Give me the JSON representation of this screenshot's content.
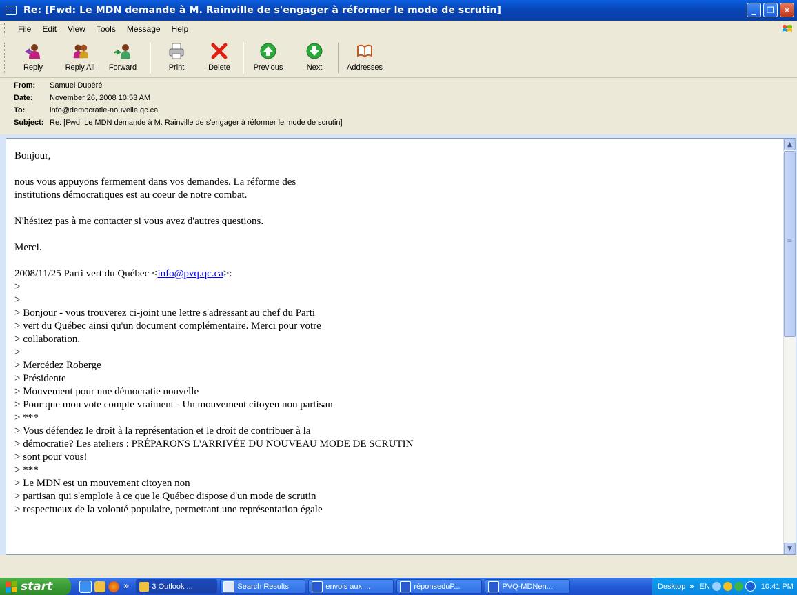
{
  "window": {
    "title": "Re: [Fwd: Le MDN demande à M. Rainville de s'engager à réformer le mode de scrutin]",
    "minimize": "_",
    "maximize": "❐",
    "close": "✕"
  },
  "menu": [
    "File",
    "Edit",
    "View",
    "Tools",
    "Message",
    "Help"
  ],
  "toolbar": {
    "reply": "Reply",
    "reply_all": "Reply All",
    "forward": "Forward",
    "print": "Print",
    "delete": "Delete",
    "previous": "Previous",
    "next": "Next",
    "addresses": "Addresses"
  },
  "headers": {
    "from_label": "From:",
    "from": "Samuel Dupéré",
    "date_label": "Date:",
    "date": "November 26, 2008 10:53 AM",
    "to_label": "To:",
    "to": "info@democratie-nouvelle.qc.ca",
    "subject_label": "Subject:",
    "subject": "Re: [Fwd: Le MDN demande à M. Rainville de s'engager à réformer le mode de scrutin]"
  },
  "body": {
    "l1": "Bonjour,",
    "l2": "nous vous appuyons fermement dans vos demandes. La réforme des",
    "l3": "institutions démocratiques est au coeur de notre combat.",
    "l4": "N'hésitez pas à me contacter si vous avez d'autres questions.",
    "l5": "Merci.",
    "quote_pre": "2008/11/25 Parti vert du Québec <",
    "quote_link": "info@pvq.qc.ca",
    "quote_post": ">:",
    "q1": ">",
    "q2": ">",
    "q3": "> Bonjour - vous trouverez ci-joint une lettre s'adressant au chef du Parti",
    "q4": "> vert du Québec ainsi qu'un document complémentaire. Merci pour votre",
    "q5": "> collaboration.",
    "q6": ">",
    "q7": "> Mercédez Roberge",
    "q8": "> Présidente",
    "q9": "> Mouvement pour une démocratie nouvelle",
    "q10": "> Pour que mon vote compte vraiment - Un mouvement citoyen non partisan",
    "q11": "> ***",
    "q12": "> Vous défendez le droit à la représentation et le droit de contribuer à la",
    "q13": "> démocratie? Les ateliers : PRÉPARONS L'ARRIVÉE DU NOUVEAU MODE DE SCRUTIN",
    "q14": "> sont pour vous!",
    "q15": "> ***",
    "q16": "> Le MDN est un mouvement citoyen non",
    "q17": "> partisan qui s'emploie à ce que le Québec dispose d'un mode de scrutin",
    "q18": "> respectueux de la volonté populaire, permettant une représentation égale"
  },
  "taskbar": {
    "start": "start",
    "overflow": "»",
    "tasks": [
      "3 Outlook ...",
      "Search Results",
      "envois aux ...",
      "réponseduP...",
      "PVQ-MDNen..."
    ],
    "desktop": "Desktop",
    "lang": "EN",
    "clock": "10:41 PM"
  }
}
